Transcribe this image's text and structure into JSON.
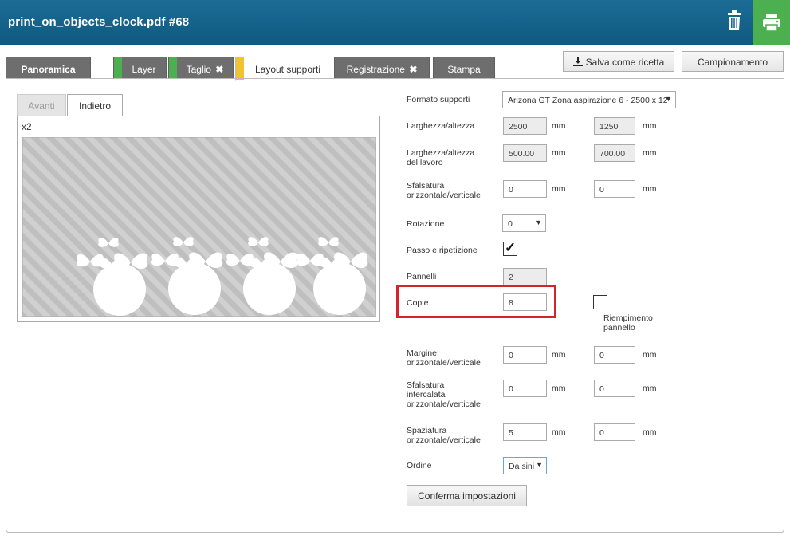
{
  "header": {
    "title": "print_on_objects_clock.pdf #68"
  },
  "tabs": {
    "overview": "Panoramica",
    "layer": "Layer",
    "cut": "Taglio",
    "media_layout": "Layout supporti",
    "registration": "Registrazione",
    "print": "Stampa",
    "close_glyph": "✖"
  },
  "actions": {
    "save_recipe": "Salva come ricetta",
    "sampling": "Campionamento"
  },
  "preview": {
    "front": "Avanti",
    "back": "Indietro",
    "multiplier": "x2"
  },
  "form": {
    "media_format": {
      "label": "Formato supporti",
      "value": "Arizona GT Zona aspirazione 6 - 2500 x 12"
    },
    "size": {
      "label": "Larghezza/altezza",
      "width": "2500",
      "height": "1250",
      "unit": "mm"
    },
    "job_size": {
      "label_1": "Larghezza/altezza",
      "label_2": "del lavoro",
      "width": "500.00",
      "height": "700.00",
      "unit": "mm"
    },
    "offset": {
      "label_1": "Sfalsatura",
      "label_2": "orizzontale/verticale",
      "h": "0",
      "v": "0",
      "unit": "mm"
    },
    "rotation": {
      "label": "Rotazione",
      "value": "0"
    },
    "step_repeat": {
      "label": "Passo e ripetizione",
      "checked": true,
      "mark": "✓"
    },
    "panels": {
      "label": "Pannelli",
      "value": "2"
    },
    "copies": {
      "label": "Copie",
      "value": "8"
    },
    "fill_panel": {
      "label_1": "Riempimento",
      "label_2": "pannello",
      "checked": false
    },
    "margin": {
      "label_1": "Margine",
      "label_2": "orizzontale/verticale",
      "h": "0",
      "v": "0",
      "unit": "mm"
    },
    "interleaved_offset": {
      "label_1": "Sfalsatura",
      "label_2": "intercalata",
      "label_3": "orizzontale/verticale",
      "h": "0",
      "v": "0",
      "unit": "mm"
    },
    "spacing": {
      "label_1": "Spaziatura",
      "label_2": "orizzontale/verticale",
      "h": "5",
      "v": "0",
      "unit": "mm"
    },
    "order": {
      "label": "Ordine",
      "value": "Da sini"
    },
    "confirm": "Conferma impostazioni"
  },
  "colors": {
    "header": "#1b6c96",
    "print_button": "#4caf50",
    "tab_dark": "#6e6e6e",
    "band_green": "#4caf50",
    "band_yellow": "#f2c230",
    "highlight": "#d3232b"
  }
}
